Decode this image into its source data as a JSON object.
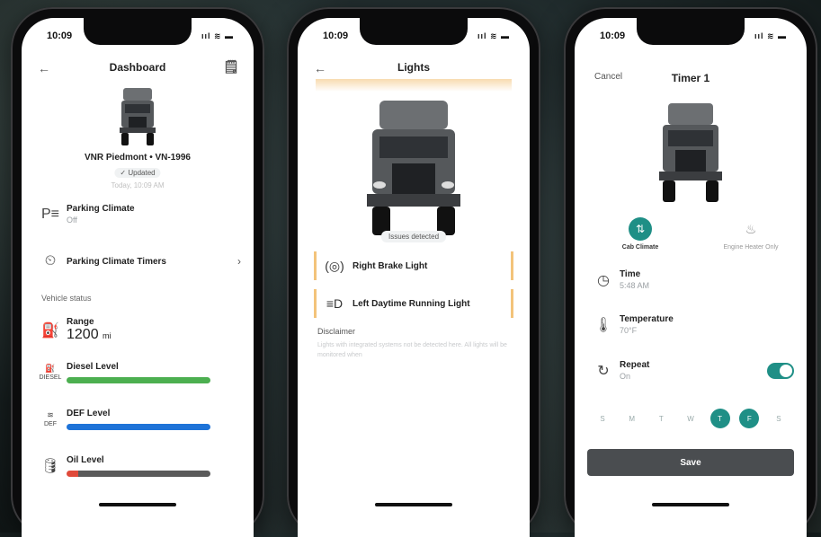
{
  "status": {
    "time": "10:09",
    "signal": "ııl ≋ ▬"
  },
  "dashboard": {
    "title": "Dashboard",
    "vehicle": "VNR Piedmont • VN-1996",
    "updated": "✓ Updated",
    "updated_time": "Today, 10:09 AM",
    "parking_climate": {
      "label": "Parking Climate",
      "value": "Off"
    },
    "parking_timers": {
      "label": "Parking Climate Timers"
    },
    "section": "Vehicle status",
    "range": {
      "label": "Range",
      "value": "1200",
      "unit": "mi"
    },
    "diesel": {
      "label": "Diesel Level",
      "icon_caption": "DIESEL",
      "level": 1.0,
      "color": "#4caf50"
    },
    "def": {
      "label": "DEF Level",
      "icon_caption": "DEF",
      "level": 1.0,
      "color": "#1e73d8"
    },
    "oil": {
      "label": "Oil Level",
      "level": 1.0,
      "color": "#5a5a5a",
      "warn_color": "#e04a3a"
    }
  },
  "lights": {
    "title": "Lights",
    "issues": "Issues detected",
    "items": [
      {
        "label": "Right Brake Light",
        "icon": "brake-light-icon"
      },
      {
        "label": "Left Daytime Running Light",
        "icon": "daytime-light-icon"
      }
    ],
    "disclaimer_title": "Disclaimer",
    "disclaimer_body": "Lights with integrated systems not be detected here. All lights will be monitored when"
  },
  "timer": {
    "cancel": "Cancel",
    "title": "Timer 1",
    "modes": [
      {
        "label": "Cab Climate",
        "active": true
      },
      {
        "label": "Engine Heater Only",
        "active": false
      }
    ],
    "time": {
      "label": "Time",
      "value": "5:48 AM"
    },
    "temperature": {
      "label": "Temperature",
      "value": "70°F"
    },
    "repeat": {
      "label": "Repeat",
      "value": "On"
    },
    "days": [
      {
        "label": "S",
        "on": false
      },
      {
        "label": "M",
        "on": false
      },
      {
        "label": "T",
        "on": false
      },
      {
        "label": "W",
        "on": false
      },
      {
        "label": "T",
        "on": true
      },
      {
        "label": "F",
        "on": true
      },
      {
        "label": "S",
        "on": false
      }
    ],
    "save": "Save"
  },
  "colors": {
    "accent": "#1f8f86",
    "warning": "#f3c37a"
  }
}
